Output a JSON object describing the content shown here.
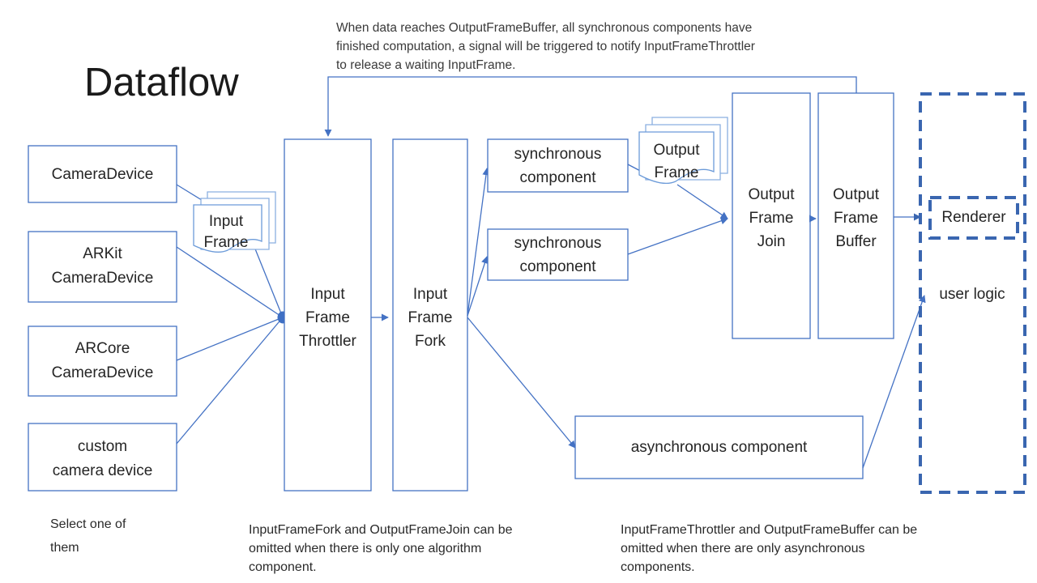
{
  "page": {
    "title": "Dataflow",
    "background_color": "#ffffff",
    "accent_color": "#4472C4",
    "dashed_color": "#3A66B0",
    "text_color": "#252525"
  },
  "note": {
    "lines": [
      "When data reaches OutputFrameBuffer, all synchronous components have",
      "finished computation, a signal will be triggered to notify InputFrameThrottler",
      "to release a waiting InputFrame."
    ]
  },
  "sources": {
    "caption_lines": [
      "Select one of",
      "them"
    ],
    "items": [
      {
        "id": "camera-device",
        "lines": [
          "CameraDevice"
        ]
      },
      {
        "id": "arkit-camera-device",
        "lines": [
          "ARKit",
          "CameraDevice"
        ]
      },
      {
        "id": "arcore-camera-device",
        "lines": [
          "ARCore",
          "CameraDevice"
        ]
      },
      {
        "id": "custom-camera-device",
        "lines": [
          "custom",
          "camera device"
        ]
      }
    ]
  },
  "frames": {
    "input_frame": {
      "lines": [
        "Input",
        "Frame"
      ],
      "stack_count": 3
    },
    "output_frame": {
      "lines": [
        "Output",
        "Frame"
      ],
      "stack_count": 3
    }
  },
  "pipeline": {
    "input_frame_throttler": {
      "lines": [
        "Input",
        "Frame",
        "Throttler"
      ]
    },
    "input_frame_fork": {
      "lines": [
        "Input",
        "Frame",
        "Fork"
      ]
    },
    "output_frame_join": {
      "lines": [
        "Output",
        "Frame",
        "Join"
      ]
    },
    "output_frame_buffer": {
      "lines": [
        "Output",
        "Frame",
        "Buffer"
      ]
    }
  },
  "components": {
    "sync_top": {
      "lines": [
        "synchronous",
        "component"
      ]
    },
    "sync_bottom": {
      "lines": [
        "synchronous",
        "component"
      ]
    },
    "async": {
      "lines": [
        "asynchronous component"
      ]
    }
  },
  "user_logic": {
    "label": "user logic",
    "renderer": "Renderer"
  },
  "captions": {
    "middle_lines": [
      "InputFrameFork and OutputFrameJoin can be",
      "omitted when there is only one algorithm",
      "component."
    ],
    "right_lines": [
      "InputFrameThrottler and OutputFrameBuffer can be",
      "omitted when there are only asynchronous",
      "components."
    ]
  }
}
